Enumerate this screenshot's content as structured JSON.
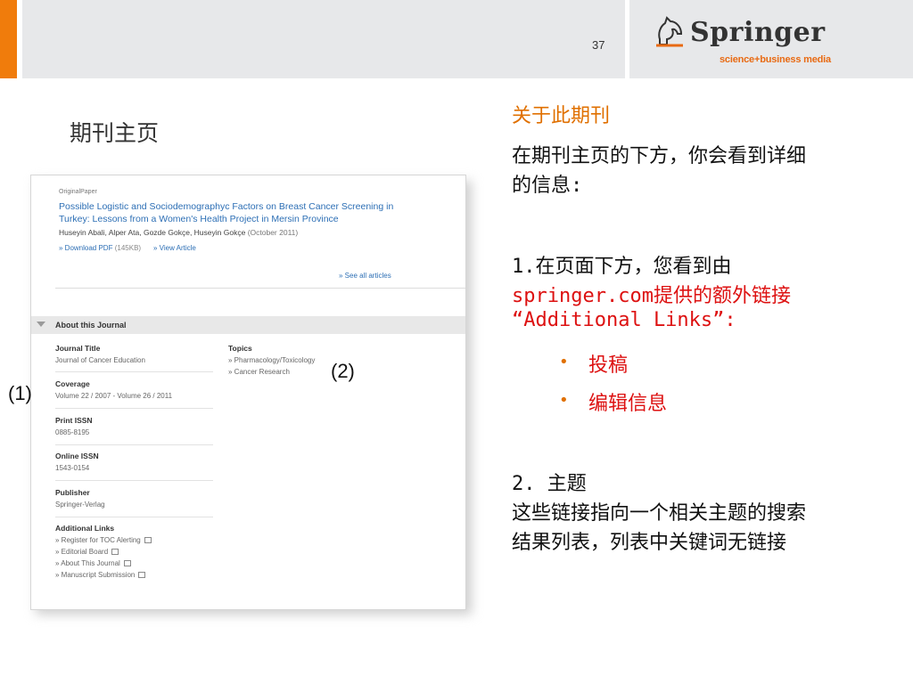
{
  "header": {
    "page_number": "37",
    "logo_word": "Springer",
    "logo_tagline": "science+business media"
  },
  "slide_title": "期刊主页",
  "screenshot": {
    "original_tag": "OriginalPaper",
    "article_title": "Possible Logistic and Sociodemographyc Factors on Breast Cancer Screening in Turkey: Lessons from a Women's Health Project in Mersin Province",
    "authors": "Huseyin Abali, Alper Ata, Gozde Gokçe, Huseyin Gokçe",
    "date": "(October 2011)",
    "download_pdf": "» Download PDF",
    "pdf_size": "(145KB)",
    "view_article": "» View Article",
    "see_all": "» See all articles",
    "about_label": "About this Journal",
    "fields": [
      {
        "label": "Journal Title",
        "value": "Journal of Cancer Education"
      },
      {
        "label": "Coverage",
        "value": "Volume 22 / 2007 - Volume 26 / 2011"
      },
      {
        "label": "Print ISSN",
        "value": "0885-8195"
      },
      {
        "label": "Online ISSN",
        "value": "1543-0154"
      },
      {
        "label": "Publisher",
        "value": "Springer-Verlag"
      }
    ],
    "topics_label": "Topics",
    "topics": [
      "» Pharmacology/Toxicology",
      "» Cancer Research"
    ],
    "additional_links_label": "Additional Links",
    "additional_links": [
      "» Register for TOC Alerting",
      "» Editorial Board",
      "» About This Journal",
      "» Manuscript Submission"
    ]
  },
  "callouts": {
    "one": "(1)",
    "two": "(2)"
  },
  "right": {
    "heading": "关于此期刊",
    "intro_line1": "在期刊主页的下方，你会看到详细",
    "intro_line2": "的信息:",
    "item1_line1": "1.在页面下方，您看到由",
    "item1_line2": "springer.com提供的额外链接",
    "item1_line3": "“Additional Links”:",
    "bullets": [
      "投稿",
      "编辑信息"
    ],
    "item2_line1": "2. 主题",
    "item2_line2": "这些链接指向一个相关主题的搜索",
    "item2_line3": "结果列表，列表中关键词无链接"
  },
  "colors": {
    "accent_orange": "#f07c0c",
    "link_blue": "#2d6fb5",
    "highlight_red": "#dd1111"
  }
}
